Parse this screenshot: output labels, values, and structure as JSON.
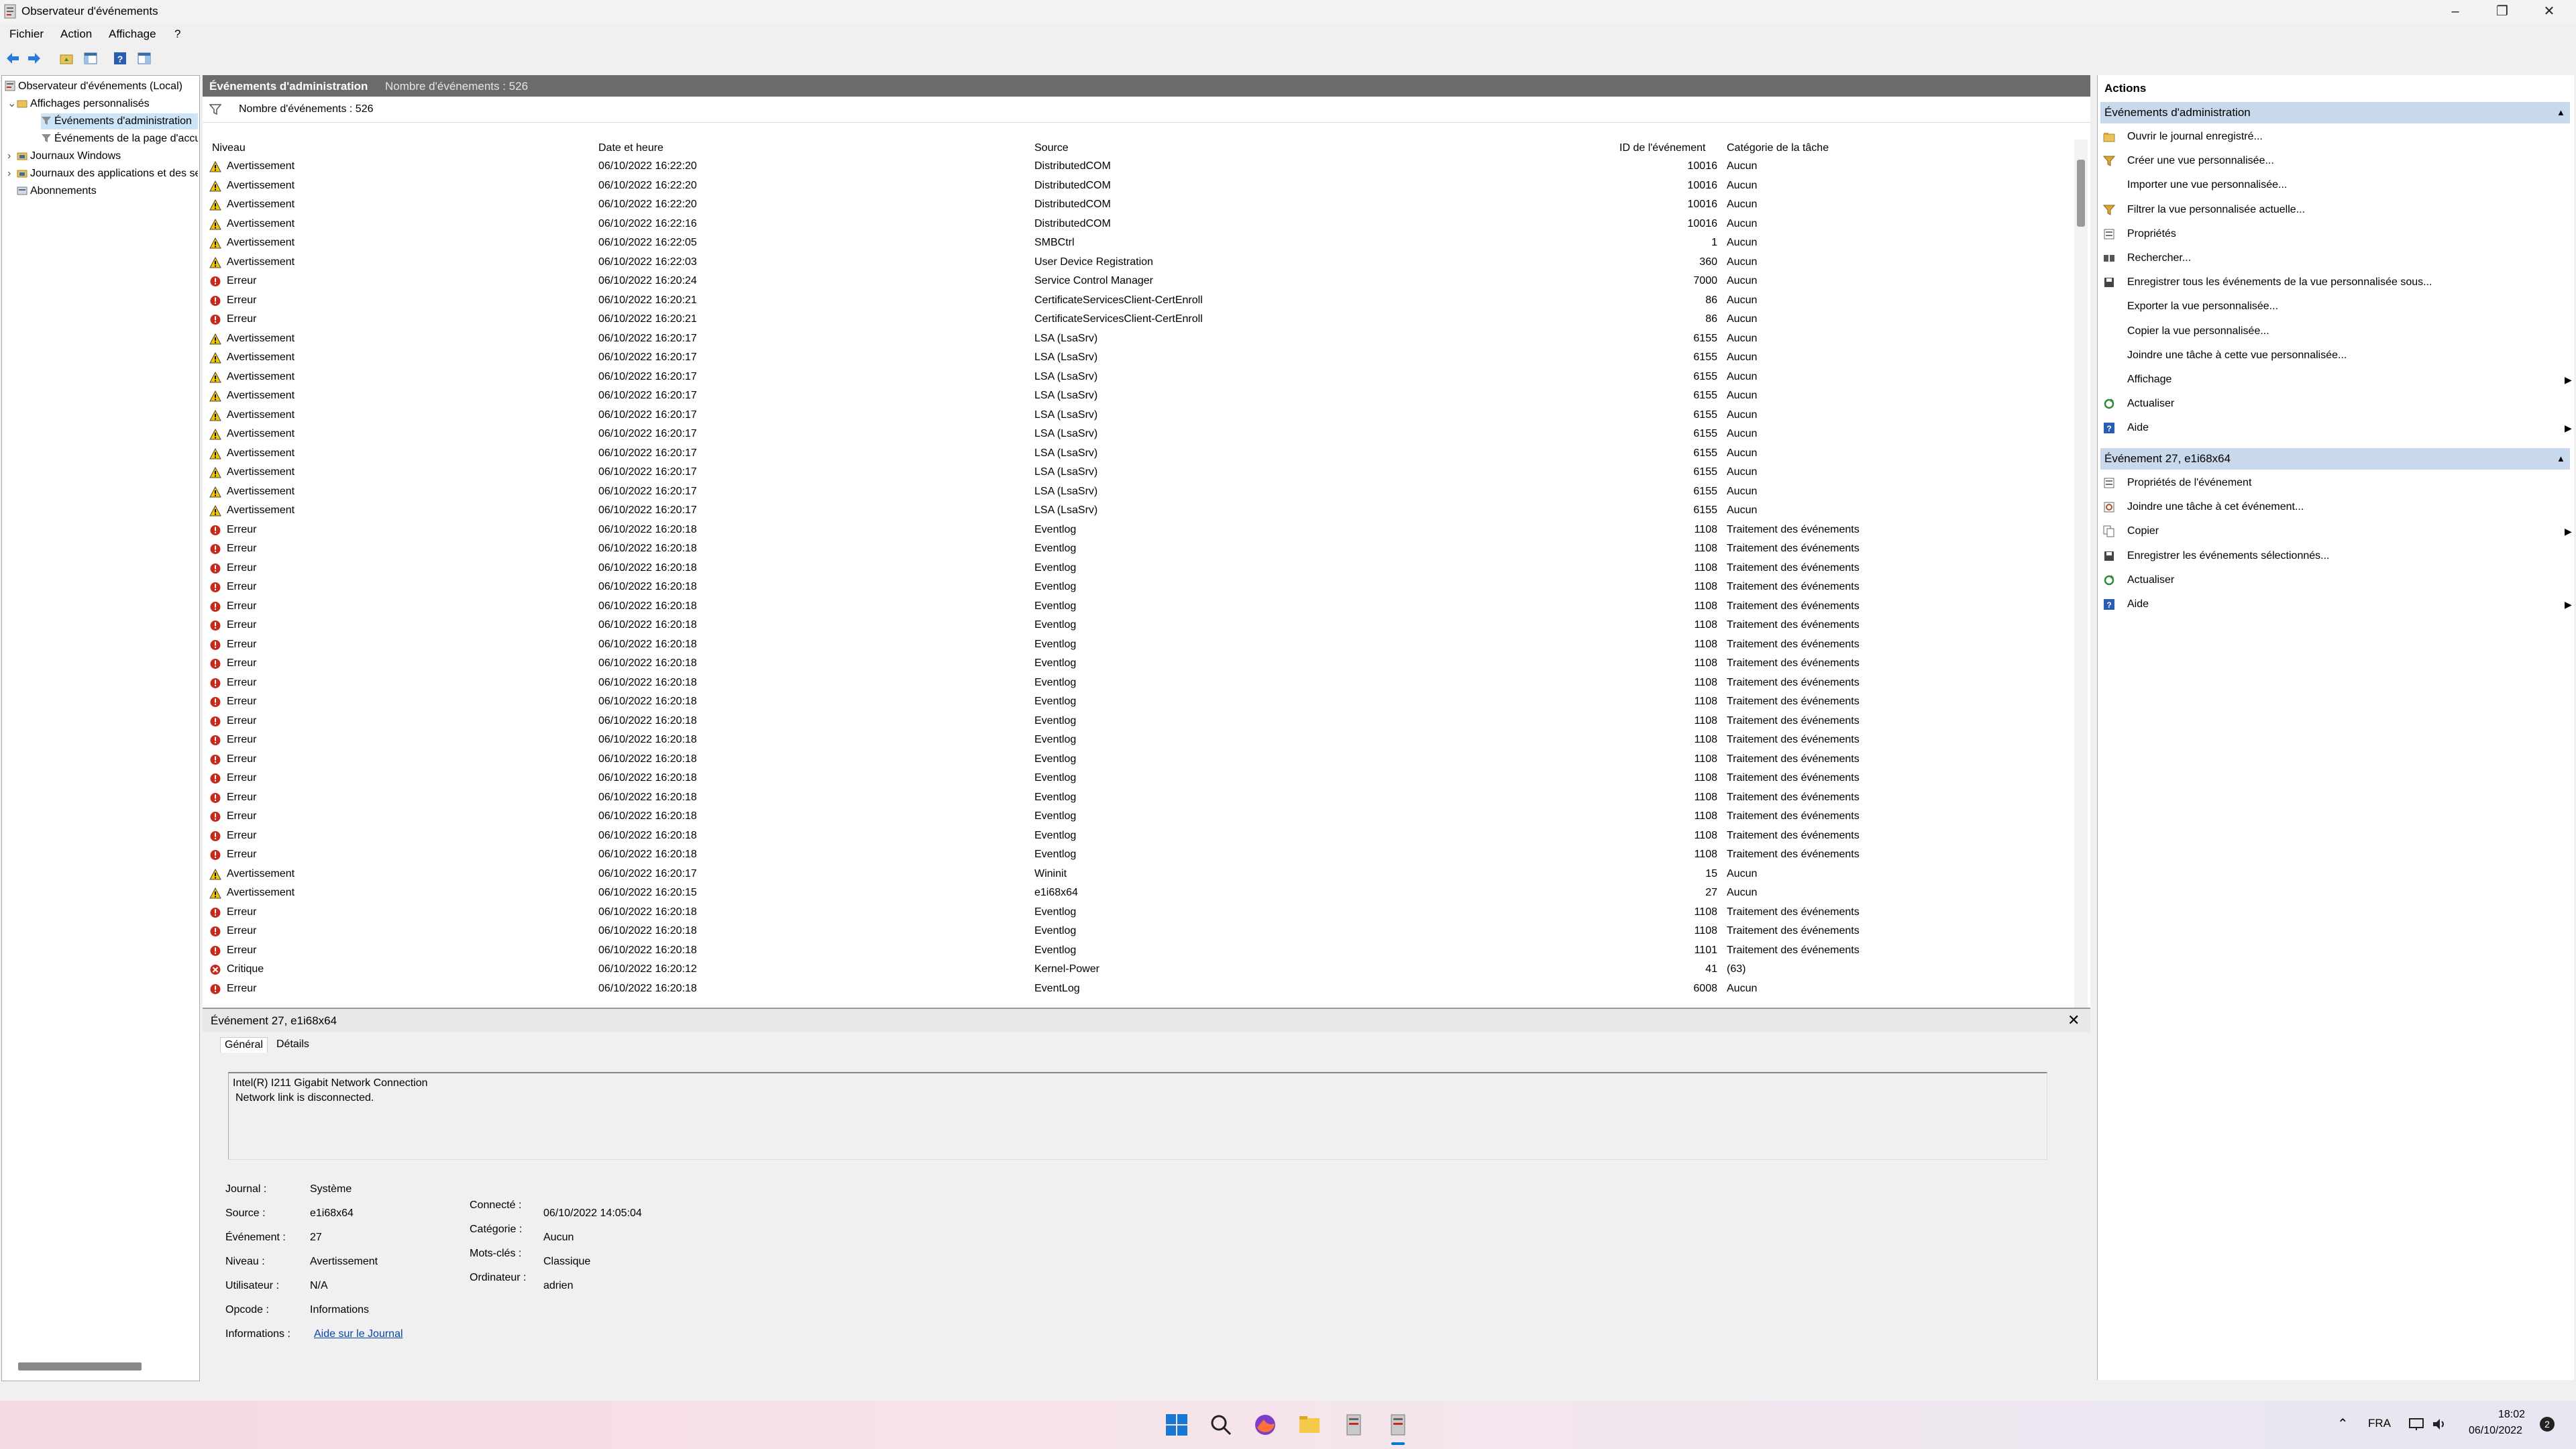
{
  "window": {
    "title": "Observateur d'événements"
  },
  "menu": [
    "Fichier",
    "Action",
    "Affichage",
    "?"
  ],
  "tree": {
    "items": [
      {
        "label": "Observateur d'événements (Local)",
        "indent": 0,
        "expander": ""
      },
      {
        "label": "Affichages personnalisés",
        "indent": 1,
        "expander": "⌄"
      },
      {
        "label": "Événements d'administration",
        "indent": 2,
        "expander": "",
        "selected": true
      },
      {
        "label": "Événements de la page d'accueil",
        "indent": 2,
        "expander": ""
      },
      {
        "label": "Journaux Windows",
        "indent": 1,
        "expander": "›"
      },
      {
        "label": "Journaux des applications et des services",
        "indent": 1,
        "expander": "›"
      },
      {
        "label": "Abonnements",
        "indent": 1,
        "expander": ""
      }
    ]
  },
  "center": {
    "header_title": "Événements d'administration",
    "header_count": "Nombre d'événements : 526",
    "filter_text": "Nombre d'événements : 526",
    "columns": [
      "Niveau",
      "Date et heure",
      "Source",
      "ID de l'événement",
      "Catégorie de la tâche"
    ],
    "rows": [
      {
        "level": "Avertissement",
        "date": "06/10/2022 16:22:20",
        "source": "DistributedCOM",
        "id": "10016",
        "category": "Aucun",
        "type": "warn"
      },
      {
        "level": "Avertissement",
        "date": "06/10/2022 16:22:20",
        "source": "DistributedCOM",
        "id": "10016",
        "category": "Aucun",
        "type": "warn"
      },
      {
        "level": "Avertissement",
        "date": "06/10/2022 16:22:20",
        "source": "DistributedCOM",
        "id": "10016",
        "category": "Aucun",
        "type": "warn"
      },
      {
        "level": "Avertissement",
        "date": "06/10/2022 16:22:16",
        "source": "DistributedCOM",
        "id": "10016",
        "category": "Aucun",
        "type": "warn"
      },
      {
        "level": "Avertissement",
        "date": "06/10/2022 16:22:05",
        "source": "SMBCtrl",
        "id": "1",
        "category": "Aucun",
        "type": "warn"
      },
      {
        "level": "Avertissement",
        "date": "06/10/2022 16:22:03",
        "source": "User Device Registration",
        "id": "360",
        "category": "Aucun",
        "type": "warn"
      },
      {
        "level": "Erreur",
        "date": "06/10/2022 16:20:24",
        "source": "Service Control Manager",
        "id": "7000",
        "category": "Aucun",
        "type": "err"
      },
      {
        "level": "Erreur",
        "date": "06/10/2022 16:20:21",
        "source": "CertificateServicesClient-CertEnroll",
        "id": "86",
        "category": "Aucun",
        "type": "err"
      },
      {
        "level": "Erreur",
        "date": "06/10/2022 16:20:21",
        "source": "CertificateServicesClient-CertEnroll",
        "id": "86",
        "category": "Aucun",
        "type": "err"
      },
      {
        "level": "Avertissement",
        "date": "06/10/2022 16:20:17",
        "source": "LSA (LsaSrv)",
        "id": "6155",
        "category": "Aucun",
        "type": "warn"
      },
      {
        "level": "Avertissement",
        "date": "06/10/2022 16:20:17",
        "source": "LSA (LsaSrv)",
        "id": "6155",
        "category": "Aucun",
        "type": "warn"
      },
      {
        "level": "Avertissement",
        "date": "06/10/2022 16:20:17",
        "source": "LSA (LsaSrv)",
        "id": "6155",
        "category": "Aucun",
        "type": "warn"
      },
      {
        "level": "Avertissement",
        "date": "06/10/2022 16:20:17",
        "source": "LSA (LsaSrv)",
        "id": "6155",
        "category": "Aucun",
        "type": "warn"
      },
      {
        "level": "Avertissement",
        "date": "06/10/2022 16:20:17",
        "source": "LSA (LsaSrv)",
        "id": "6155",
        "category": "Aucun",
        "type": "warn"
      },
      {
        "level": "Avertissement",
        "date": "06/10/2022 16:20:17",
        "source": "LSA (LsaSrv)",
        "id": "6155",
        "category": "Aucun",
        "type": "warn"
      },
      {
        "level": "Avertissement",
        "date": "06/10/2022 16:20:17",
        "source": "LSA (LsaSrv)",
        "id": "6155",
        "category": "Aucun",
        "type": "warn"
      },
      {
        "level": "Avertissement",
        "date": "06/10/2022 16:20:17",
        "source": "LSA (LsaSrv)",
        "id": "6155",
        "category": "Aucun",
        "type": "warn"
      },
      {
        "level": "Avertissement",
        "date": "06/10/2022 16:20:17",
        "source": "LSA (LsaSrv)",
        "id": "6155",
        "category": "Aucun",
        "type": "warn"
      },
      {
        "level": "Avertissement",
        "date": "06/10/2022 16:20:17",
        "source": "LSA (LsaSrv)",
        "id": "6155",
        "category": "Aucun",
        "type": "warn"
      },
      {
        "level": "Erreur",
        "date": "06/10/2022 16:20:18",
        "source": "Eventlog",
        "id": "1108",
        "category": "Traitement des événements",
        "type": "err"
      },
      {
        "level": "Erreur",
        "date": "06/10/2022 16:20:18",
        "source": "Eventlog",
        "id": "1108",
        "category": "Traitement des événements",
        "type": "err"
      },
      {
        "level": "Erreur",
        "date": "06/10/2022 16:20:18",
        "source": "Eventlog",
        "id": "1108",
        "category": "Traitement des événements",
        "type": "err"
      },
      {
        "level": "Erreur",
        "date": "06/10/2022 16:20:18",
        "source": "Eventlog",
        "id": "1108",
        "category": "Traitement des événements",
        "type": "err"
      },
      {
        "level": "Erreur",
        "date": "06/10/2022 16:20:18",
        "source": "Eventlog",
        "id": "1108",
        "category": "Traitement des événements",
        "type": "err"
      },
      {
        "level": "Erreur",
        "date": "06/10/2022 16:20:18",
        "source": "Eventlog",
        "id": "1108",
        "category": "Traitement des événements",
        "type": "err"
      },
      {
        "level": "Erreur",
        "date": "06/10/2022 16:20:18",
        "source": "Eventlog",
        "id": "1108",
        "category": "Traitement des événements",
        "type": "err"
      },
      {
        "level": "Erreur",
        "date": "06/10/2022 16:20:18",
        "source": "Eventlog",
        "id": "1108",
        "category": "Traitement des événements",
        "type": "err"
      },
      {
        "level": "Erreur",
        "date": "06/10/2022 16:20:18",
        "source": "Eventlog",
        "id": "1108",
        "category": "Traitement des événements",
        "type": "err"
      },
      {
        "level": "Erreur",
        "date": "06/10/2022 16:20:18",
        "source": "Eventlog",
        "id": "1108",
        "category": "Traitement des événements",
        "type": "err"
      },
      {
        "level": "Erreur",
        "date": "06/10/2022 16:20:18",
        "source": "Eventlog",
        "id": "1108",
        "category": "Traitement des événements",
        "type": "err"
      },
      {
        "level": "Erreur",
        "date": "06/10/2022 16:20:18",
        "source": "Eventlog",
        "id": "1108",
        "category": "Traitement des événements",
        "type": "err"
      },
      {
        "level": "Erreur",
        "date": "06/10/2022 16:20:18",
        "source": "Eventlog",
        "id": "1108",
        "category": "Traitement des événements",
        "type": "err"
      },
      {
        "level": "Erreur",
        "date": "06/10/2022 16:20:18",
        "source": "Eventlog",
        "id": "1108",
        "category": "Traitement des événements",
        "type": "err"
      },
      {
        "level": "Erreur",
        "date": "06/10/2022 16:20:18",
        "source": "Eventlog",
        "id": "1108",
        "category": "Traitement des événements",
        "type": "err"
      },
      {
        "level": "Erreur",
        "date": "06/10/2022 16:20:18",
        "source": "Eventlog",
        "id": "1108",
        "category": "Traitement des événements",
        "type": "err"
      },
      {
        "level": "Erreur",
        "date": "06/10/2022 16:20:18",
        "source": "Eventlog",
        "id": "1108",
        "category": "Traitement des événements",
        "type": "err"
      },
      {
        "level": "Erreur",
        "date": "06/10/2022 16:20:18",
        "source": "Eventlog",
        "id": "1108",
        "category": "Traitement des événements",
        "type": "err"
      },
      {
        "level": "Avertissement",
        "date": "06/10/2022 16:20:17",
        "source": "Wininit",
        "id": "15",
        "category": "Aucun",
        "type": "warn"
      },
      {
        "level": "Avertissement",
        "date": "06/10/2022 16:20:15",
        "source": "e1i68x64",
        "id": "27",
        "category": "Aucun",
        "type": "warn"
      },
      {
        "level": "Erreur",
        "date": "06/10/2022 16:20:18",
        "source": "Eventlog",
        "id": "1108",
        "category": "Traitement des événements",
        "type": "err"
      },
      {
        "level": "Erreur",
        "date": "06/10/2022 16:20:18",
        "source": "Eventlog",
        "id": "1108",
        "category": "Traitement des événements",
        "type": "err"
      },
      {
        "level": "Erreur",
        "date": "06/10/2022 16:20:18",
        "source": "Eventlog",
        "id": "1101",
        "category": "Traitement des événements",
        "type": "err"
      },
      {
        "level": "Critique",
        "date": "06/10/2022 16:20:12",
        "source": "Kernel-Power",
        "id": "41",
        "category": "(63)",
        "type": "crit"
      },
      {
        "level": "Erreur",
        "date": "06/10/2022 16:20:18",
        "source": "EventLog",
        "id": "6008",
        "category": "Aucun",
        "type": "err"
      }
    ]
  },
  "details": {
    "title": "Événement 27, e1i68x64",
    "tabs": [
      "Général",
      "Détails"
    ],
    "message_line1": "Intel(R) I211 Gigabit Network Connection",
    "message_line2": "Network link is disconnected.",
    "left_props": [
      {
        "label": "Journal :",
        "value": "Système"
      },
      {
        "label": "Source :",
        "value": "e1i68x64"
      },
      {
        "label": "Événement :",
        "value": "27"
      },
      {
        "label": "Niveau :",
        "value": "Avertissement"
      },
      {
        "label": "Utilisateur :",
        "value": "N/A"
      },
      {
        "label": "Opcode :",
        "value": "Informations"
      },
      {
        "label": "Informations :",
        "value": "Aide sur le Journal"
      }
    ],
    "right_props": [
      {
        "label": "Connecté :",
        "value": "06/10/2022 14:05:04"
      },
      {
        "label": "Catégorie :",
        "value": "Aucun"
      },
      {
        "label": "Mots-clés :",
        "value": "Classique"
      },
      {
        "label": "Ordinateur :",
        "value": "adrien"
      }
    ]
  },
  "actions": {
    "title": "Actions",
    "section1": {
      "title": "Événements d'administration",
      "items": [
        {
          "label": "Ouvrir le journal enregistré...",
          "icon": "folder-icon"
        },
        {
          "label": "Créer une vue personnalisée...",
          "icon": "filter-icon"
        },
        {
          "label": "Importer une vue personnalisée...",
          "icon": ""
        },
        {
          "label": "Filtrer la vue personnalisée actuelle...",
          "icon": "filter-icon"
        },
        {
          "label": "Propriétés",
          "icon": "properties-icon"
        },
        {
          "label": "Rechercher...",
          "icon": "find-icon"
        },
        {
          "label": "Enregistrer tous les événements de la vue personnalisée sous...",
          "icon": "save-icon"
        },
        {
          "label": "Exporter la vue personnalisée...",
          "icon": ""
        },
        {
          "label": "Copier la vue personnalisée...",
          "icon": ""
        },
        {
          "label": "Joindre une tâche à cette vue personnalisée...",
          "icon": ""
        },
        {
          "label": "Affichage",
          "icon": "",
          "submenu": true
        },
        {
          "label": "Actualiser",
          "icon": "refresh-icon"
        },
        {
          "label": "Aide",
          "icon": "help-icon",
          "submenu": true
        }
      ]
    },
    "section2": {
      "title": "Événement 27, e1i68x64",
      "items": [
        {
          "label": "Propriétés de l'événement",
          "icon": "properties-icon"
        },
        {
          "label": "Joindre une tâche à cet événement...",
          "icon": "task-icon"
        },
        {
          "label": "Copier",
          "icon": "copy-icon",
          "submenu": true
        },
        {
          "label": "Enregistrer les événements sélectionnés...",
          "icon": "save-icon"
        },
        {
          "label": "Actualiser",
          "icon": "refresh-icon"
        },
        {
          "label": "Aide",
          "icon": "help-icon",
          "submenu": true
        }
      ]
    }
  },
  "taskbar": {
    "language": "FRA",
    "time": "18:02",
    "date": "06/10/2022",
    "notifications": "2"
  },
  "colors": {
    "accent": "#0078d4",
    "warning": "#f2c500",
    "error": "#c42b1c",
    "section_header": "#c9d9ec"
  }
}
